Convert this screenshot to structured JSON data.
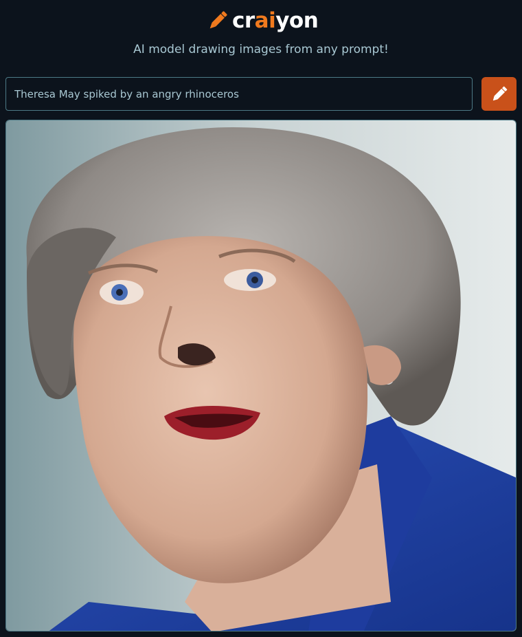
{
  "logo": {
    "text_prefix": "cr",
    "text_accent": "ai",
    "text_suffix": "yon",
    "icon": "pencil-icon"
  },
  "tagline": "AI model drawing images from any prompt!",
  "prompt": {
    "value": "Theresa May spiked by an angry rhinoceros",
    "placeholder": ""
  },
  "draw_button": {
    "icon": "pencil-icon"
  },
  "result_image": {
    "alt": "Theresa May spiked by an angry rhinoceros"
  },
  "colors": {
    "background": "#0c131c",
    "accent": "#f07a1e",
    "button": "#c9511a",
    "border": "#4d7a86",
    "text_muted": "#a9c8d3"
  }
}
